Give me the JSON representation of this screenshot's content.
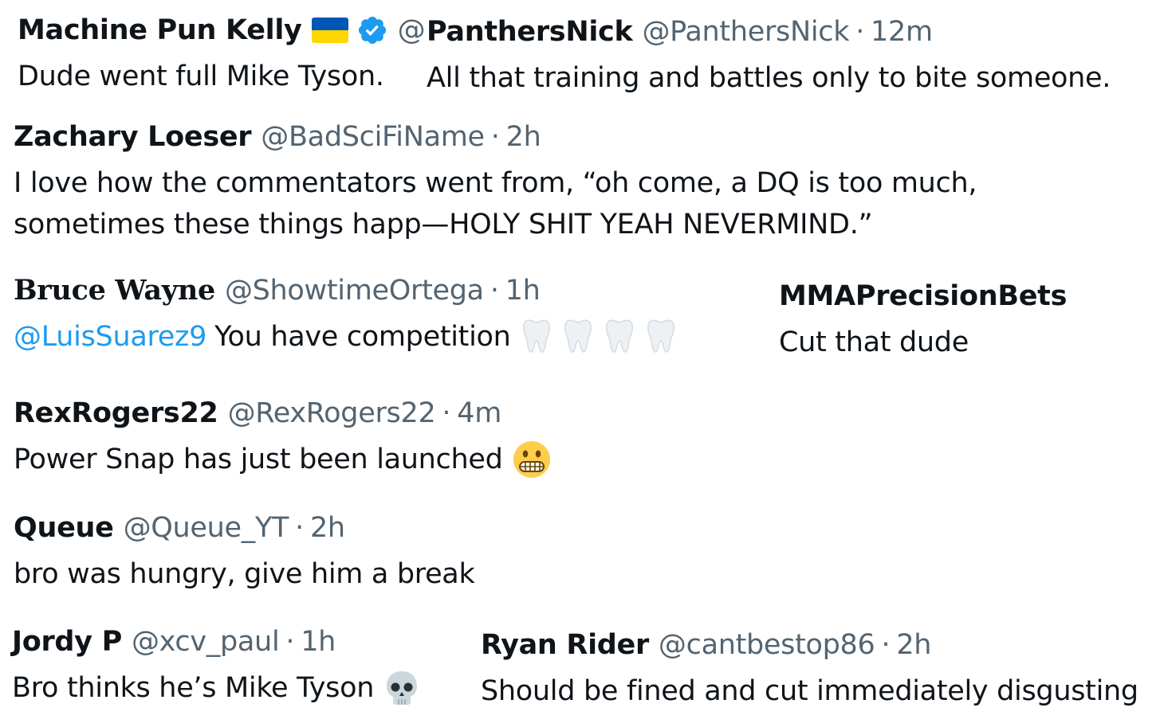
{
  "tweets": [
    {
      "name": "Machine Pun Kelly",
      "handle": "@",
      "text": "Dude went full Mike Tyson."
    },
    {
      "name": "PanthersNick",
      "handle": "@PanthersNick",
      "sep": "·",
      "time": "12m",
      "text": "All that training and battles only to bite someone."
    },
    {
      "name": "Zachary Loeser",
      "handle": "@BadSciFiName",
      "sep": "·",
      "time": "2h",
      "text": "I love how the commentators went from, “oh come, a DQ is too much, sometimes these things happ—HOLY SHIT YEAH NEVERMIND.”"
    },
    {
      "name": "Bruce Wayne",
      "handle": "@ShowtimeOrtega",
      "sep": "·",
      "time": "1h",
      "mention": "@LuisSuarez9",
      "text": "You have competition"
    },
    {
      "name": "MMAPrecisionBets",
      "text": "Cut that dude"
    },
    {
      "name": "RexRogers22",
      "handle": "@RexRogers22",
      "sep": "·",
      "time": "4m",
      "text": "Power Snap has just been launched"
    },
    {
      "name": "Queue",
      "handle": "@Queue_YT",
      "sep": "·",
      "time": "2h",
      "text": "bro was hungry, give him a break"
    },
    {
      "name": "Jordy P",
      "handle": "@xcv_paul",
      "sep": "·",
      "time": "1h",
      "text": "Bro thinks he’s Mike Tyson"
    },
    {
      "name": "Ryan Rider",
      "handle": "@cantbestop86",
      "sep": "·",
      "time": "2h",
      "text": "Should be fined and cut immediately disgusting"
    }
  ],
  "icons": {
    "flag": "ukraine-flag-icon",
    "verified": "verified-badge-icon",
    "tooth": "tooth-emoji-icon",
    "grimace": "grimacing-face-emoji-icon",
    "skull": "skull-emoji-icon"
  },
  "colors": {
    "text": "#0f1419",
    "secondary": "#536471",
    "link": "#1d9bf0",
    "verified": "#1d9bf0"
  }
}
